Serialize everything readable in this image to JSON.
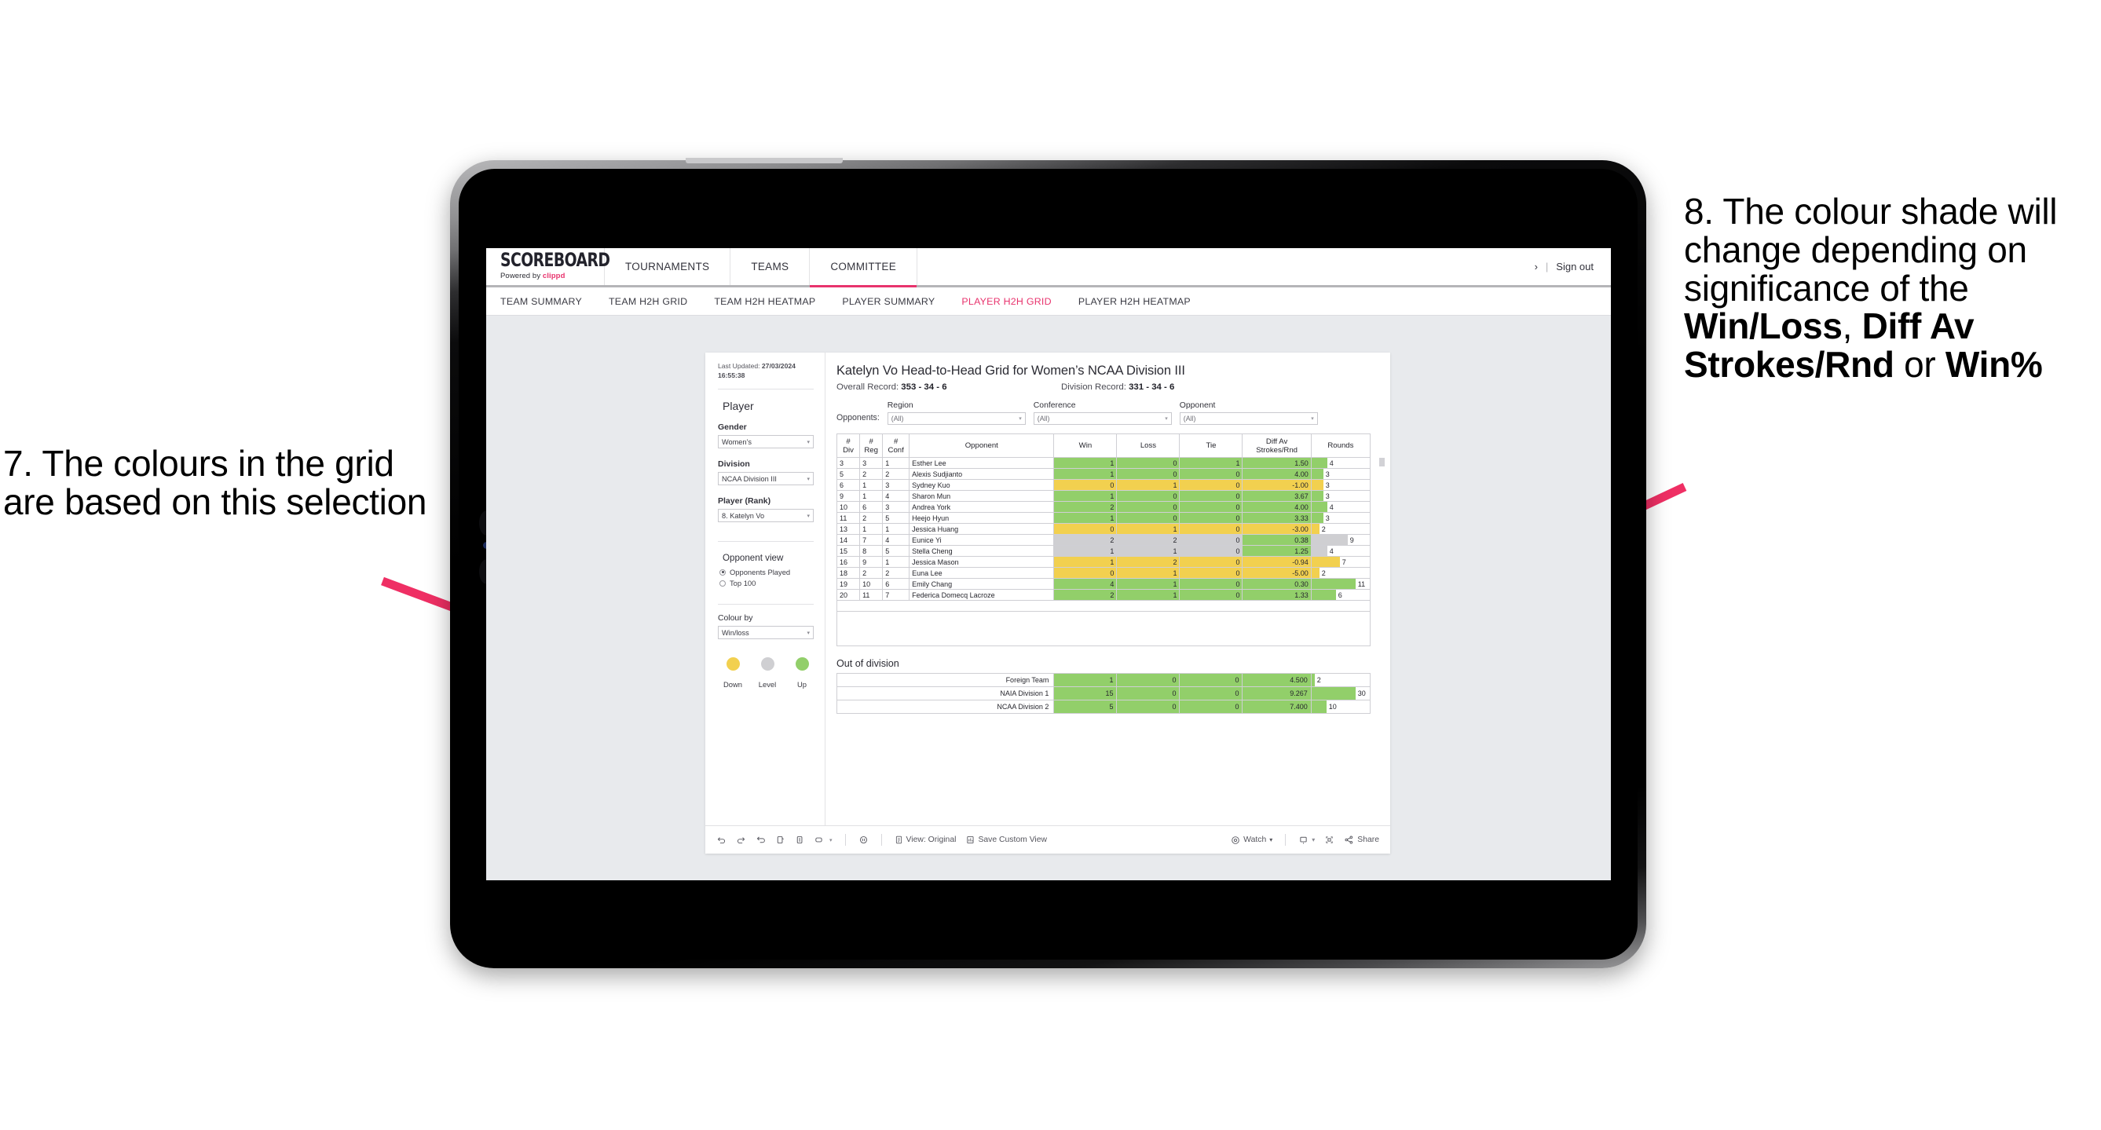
{
  "annotations": {
    "left": {
      "number": "7.",
      "text": "The colours in the grid are based on this selection"
    },
    "right_pre": "8. The colour shade will change depending on significance of the ",
    "right_b1": "Win/Loss",
    "right_mid1": ", ",
    "right_b2": "Diff Av Strokes/Rnd",
    "right_mid2": " or ",
    "right_b3": "Win%",
    "arrow_color": "#ef2f64"
  },
  "header": {
    "logo_main": "SCOREBOARD",
    "logo_sub_prefix": "Powered by ",
    "logo_sub_brand": "clippd",
    "nav": [
      {
        "label": "TOURNAMENTS",
        "active": false
      },
      {
        "label": "TEAMS",
        "active": false
      },
      {
        "label": "COMMITTEE",
        "active": true
      }
    ],
    "chevron": "›",
    "separator": "|",
    "sign_out": "Sign out"
  },
  "subnav": [
    {
      "label": "TEAM SUMMARY",
      "active": false
    },
    {
      "label": "TEAM H2H GRID",
      "active": false
    },
    {
      "label": "TEAM H2H HEATMAP",
      "active": false
    },
    {
      "label": "PLAYER SUMMARY",
      "active": false
    },
    {
      "label": "PLAYER H2H GRID",
      "active": true
    },
    {
      "label": "PLAYER H2H HEATMAP",
      "active": false
    }
  ],
  "sidebar": {
    "updated_label": "Last Updated: ",
    "updated_value": "27/03/2024 16:55:38",
    "section_player": "Player",
    "fields": [
      {
        "label": "Gender",
        "value": "Women’s"
      },
      {
        "label": "Division",
        "value": "NCAA Division III"
      },
      {
        "label": "Player (Rank)",
        "value": "8. Katelyn Vo"
      }
    ],
    "opponent_view_title": "Opponent view",
    "opponent_view_options": [
      {
        "label": "Opponents Played",
        "selected": true
      },
      {
        "label": "Top 100",
        "selected": false
      }
    ],
    "colour_by_label": "Colour by",
    "colour_by_value": "Win/loss",
    "legend": [
      {
        "caption": "Down",
        "color": "#f2d04f"
      },
      {
        "caption": "Level",
        "color": "#cfcfd2"
      },
      {
        "caption": "Up",
        "color": "#92cf6a"
      }
    ]
  },
  "main": {
    "title": "Katelyn Vo Head-to-Head Grid for Women’s NCAA Division III",
    "overall_label": "Overall Record: ",
    "overall_value": "353 -  34 - 6",
    "division_label": "Division Record: ",
    "division_value": "331 -  34 - 6",
    "opponents_label": "Opponents:",
    "filters": [
      {
        "label": "Region",
        "value": "(All)"
      },
      {
        "label": "Conference",
        "value": "(All)"
      },
      {
        "label": "Opponent",
        "value": "(All)"
      }
    ],
    "out_of_division_title": "Out of division"
  },
  "chart_data": {
    "type": "table",
    "title": "Katelyn Vo Head-to-Head Grid for Women’s NCAA Division III",
    "columns": [
      "# Div",
      "# Reg",
      "# Conf",
      "Opponent",
      "Win",
      "Loss",
      "Tie",
      "Diff Av Strokes/Rnd",
      "Rounds"
    ],
    "column_header_lines": [
      [
        "#",
        "Div"
      ],
      [
        "#",
        "Reg"
      ],
      [
        "#",
        "Conf"
      ],
      [
        "Opponent"
      ],
      [
        "Win"
      ],
      [
        "Loss"
      ],
      [
        "Tie"
      ],
      [
        "Diff Av",
        "Strokes/Rnd"
      ],
      [
        "Rounds"
      ]
    ],
    "rounds_max": 11,
    "rows": [
      {
        "div": "3",
        "reg": "3",
        "conf": "1",
        "opponent": "Esther Lee",
        "win": "1",
        "loss": "0",
        "tie": "1",
        "diff": "1.50",
        "rounds": "4",
        "status": "up"
      },
      {
        "div": "5",
        "reg": "2",
        "conf": "2",
        "opponent": "Alexis Sudjianto",
        "win": "1",
        "loss": "0",
        "tie": "0",
        "diff": "4.00",
        "rounds": "3",
        "status": "up"
      },
      {
        "div": "6",
        "reg": "1",
        "conf": "3",
        "opponent": "Sydney Kuo",
        "win": "0",
        "loss": "1",
        "tie": "0",
        "diff": "-1.00",
        "rounds": "3",
        "status": "down"
      },
      {
        "div": "9",
        "reg": "1",
        "conf": "4",
        "opponent": "Sharon Mun",
        "win": "1",
        "loss": "0",
        "tie": "0",
        "diff": "3.67",
        "rounds": "3",
        "status": "up"
      },
      {
        "div": "10",
        "reg": "6",
        "conf": "3",
        "opponent": "Andrea York",
        "win": "2",
        "loss": "0",
        "tie": "0",
        "diff": "4.00",
        "rounds": "4",
        "status": "up"
      },
      {
        "div": "11",
        "reg": "2",
        "conf": "5",
        "opponent": "Heejo Hyun",
        "win": "1",
        "loss": "0",
        "tie": "0",
        "diff": "3.33",
        "rounds": "3",
        "status": "up"
      },
      {
        "div": "13",
        "reg": "1",
        "conf": "1",
        "opponent": "Jessica Huang",
        "win": "0",
        "loss": "1",
        "tie": "0",
        "diff": "-3.00",
        "rounds": "2",
        "status": "down"
      },
      {
        "div": "14",
        "reg": "7",
        "conf": "4",
        "opponent": "Eunice Yi",
        "win": "2",
        "loss": "2",
        "tie": "0",
        "diff": "0.38",
        "rounds": "9",
        "status": "level",
        "diff_status": "up"
      },
      {
        "div": "15",
        "reg": "8",
        "conf": "5",
        "opponent": "Stella Cheng",
        "win": "1",
        "loss": "1",
        "tie": "0",
        "diff": "1.25",
        "rounds": "4",
        "status": "level",
        "diff_status": "up"
      },
      {
        "div": "16",
        "reg": "9",
        "conf": "1",
        "opponent": "Jessica Mason",
        "win": "1",
        "loss": "2",
        "tie": "0",
        "diff": "-0.94",
        "rounds": "7",
        "status": "down"
      },
      {
        "div": "18",
        "reg": "2",
        "conf": "2",
        "opponent": "Euna Lee",
        "win": "0",
        "loss": "1",
        "tie": "0",
        "diff": "-5.00",
        "rounds": "2",
        "status": "down"
      },
      {
        "div": "19",
        "reg": "10",
        "conf": "6",
        "opponent": "Emily Chang",
        "win": "4",
        "loss": "1",
        "tie": "0",
        "diff": "0.30",
        "rounds": "11",
        "status": "up"
      },
      {
        "div": "20",
        "reg": "11",
        "conf": "7",
        "opponent": "Federica Domecq Lacroze",
        "win": "2",
        "loss": "1",
        "tie": "0",
        "diff": "1.33",
        "rounds": "6",
        "status": "up"
      }
    ],
    "out_of_division": {
      "rounds_max": 30,
      "rows": [
        {
          "name": "Foreign Team",
          "win": "1",
          "loss": "0",
          "tie": "0",
          "diff": "4.500",
          "rounds": "2",
          "status": "up"
        },
        {
          "name": "NAIA Division 1",
          "win": "15",
          "loss": "0",
          "tie": "0",
          "diff": "9.267",
          "rounds": "30",
          "status": "up"
        },
        {
          "name": "NCAA Division 2",
          "win": "5",
          "loss": "0",
          "tie": "0",
          "diff": "7.400",
          "rounds": "10",
          "status": "up"
        }
      ]
    }
  },
  "toolbar": {
    "view_label": "View: Original",
    "save_label": "Save Custom View",
    "watch_label": "Watch",
    "share_label": "Share",
    "caret": "▾"
  }
}
